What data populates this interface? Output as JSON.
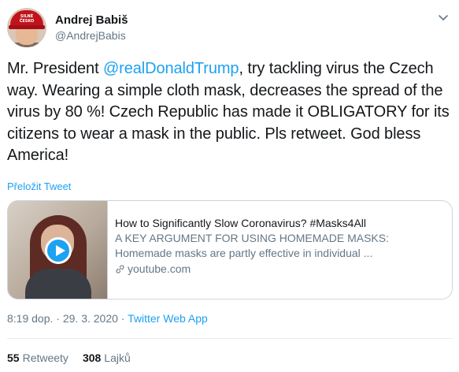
{
  "user": {
    "display_name": "Andrej Babiš",
    "handle": "@AndrejBabis",
    "avatar_cap_text_line1": "SILNÉ",
    "avatar_cap_text_line2": "ČESKO"
  },
  "tweet": {
    "text_before_mention": "Mr. President ",
    "mention": "@realDonaldTrump",
    "text_after_mention": ", try tackling virus the Czech way. Wearing a simple cloth mask, decreases the spread of the virus by 80 %! Czech Republic has made it OBLIGATORY for its citizens to wear a mask in the public. Pls retweet. God bless America!",
    "translate_label": "Přeložit Tweet"
  },
  "card": {
    "title": "How to Significantly Slow Coronavirus? #Masks4All",
    "description_line1": "A KEY ARGUMENT FOR USING HOMEMADE MASKS:",
    "description_line2": "Homemade masks are partly effective in individual ...",
    "domain": "youtube.com"
  },
  "meta": {
    "time": "8:19 dop.",
    "separator": " · ",
    "date": "29. 3. 2020",
    "app": "Twitter Web App"
  },
  "stats": {
    "retweets_count": "55",
    "retweets_label": "Retweety",
    "likes_count": "308",
    "likes_label": "Lajků"
  },
  "colors": {
    "accent": "#1da1f2",
    "secondary_text": "#657786",
    "primary_text": "#14171a",
    "border": "#ccd6dd"
  },
  "icons": {
    "menu": "chevron-down-icon",
    "play": "play-icon",
    "link": "link-icon"
  }
}
